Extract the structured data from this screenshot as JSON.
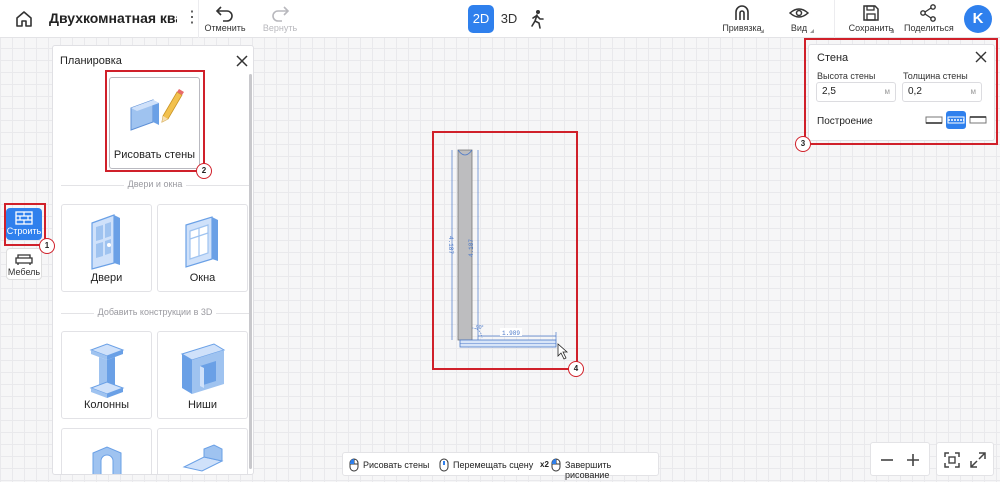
{
  "header": {
    "project_title": "Двухкомнатная квар",
    "undo_label": "Отменить",
    "redo_label": "Вернуть",
    "mode_2d": "2D",
    "mode_3d": "3D",
    "snap_label": "Привязка",
    "view_label": "Вид",
    "save_label": "Сохранить",
    "share_label": "Поделиться",
    "avatar_initial": "K"
  },
  "rail": {
    "build_label": "Строить",
    "furniture_label": "Мебель"
  },
  "panel": {
    "title": "Планировка",
    "draw_walls": "Рисовать стены",
    "section_doors_windows": "Двери и окна",
    "doors": "Двери",
    "windows": "Окна",
    "section_3d": "Добавить конструкции в 3D",
    "columns": "Колонны",
    "niches": "Ниши"
  },
  "wall_panel": {
    "title": "Стена",
    "height_label": "Высота стены",
    "height_value": "2,5",
    "thickness_label": "Толщина стены",
    "thickness_value": "0,2",
    "unit": "м",
    "build_label": "Построение"
  },
  "hints": {
    "draw": "Рисовать стены",
    "move": "Перемещать сцену",
    "finish_prefix": "x2",
    "finish": "Завершить рисование"
  },
  "drawing": {
    "vertical_dim_left": "4.187",
    "vertical_dim_right": "4.187",
    "horizontal_dim": "1.989",
    "angle": "90°"
  },
  "badges": [
    "1",
    "2",
    "3",
    "4"
  ],
  "colors": {
    "accent": "#2f80ed",
    "highlight": "#d0202a"
  }
}
